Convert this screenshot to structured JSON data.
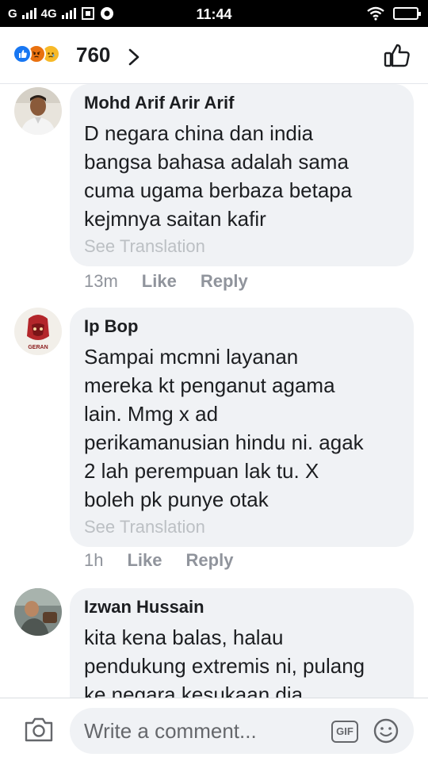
{
  "status_bar": {
    "carrier": "G",
    "network": "4G",
    "time": "11:44"
  },
  "header": {
    "reaction_icons": [
      "like-reaction-icon",
      "angry-reaction-icon",
      "sad-reaction-icon"
    ],
    "reaction_count": "760"
  },
  "comments": [
    {
      "author": "Mohd Arif Arir Arif",
      "text": "D negara china dan india\nbangsa bahasa adalah sama\ncuma ugama berbaza  betapa\nkejmnya saitan kafir",
      "see_translation": "See Translation",
      "time": "13m",
      "like": "Like",
      "reply": "Reply"
    },
    {
      "author": "Ip Bop",
      "avatar_text": "GERAN",
      "text": "Sampai mcmni layanan\nmereka kt penganut agama\nlain. Mmg x ad\nperikamanusian hindu ni. agak\n2 lah perempuan lak tu. X\nboleh pk punye otak",
      "see_translation": "See Translation",
      "time": "1h",
      "like": "Like",
      "reply": "Reply"
    },
    {
      "author": "Izwan Hussain",
      "text": "kita kena balas, halau\npendukung extremis ni, pulang\nke negara kesukaan dia"
    }
  ],
  "composer": {
    "placeholder": "Write a comment...",
    "gif_label": "GIF"
  },
  "colors": {
    "like_blue": "#1877f2",
    "bubble_bg": "#f0f2f5",
    "meta_gray": "#90949c"
  }
}
